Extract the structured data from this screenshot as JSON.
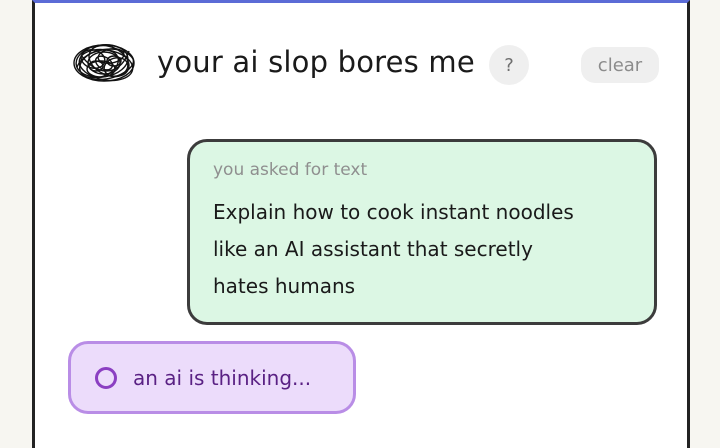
{
  "header": {
    "logo_icon": "scribble-logo-icon",
    "title": "your ai slop bores me",
    "help_label": "?",
    "clear_label": "clear"
  },
  "conversation": {
    "user_message": {
      "caption": "you asked for text",
      "lines": [
        "Explain how to cook instant noodles",
        "like an AI assistant that secretly",
        "hates humans"
      ]
    },
    "status": {
      "spinner_icon": "loading-ring-icon",
      "text": "an ai is thinking..."
    }
  },
  "colors": {
    "top_accent": "#5b6bd6",
    "user_bubble_bg": "#dcf7e4",
    "thinking_bg": "#ecdcfb",
    "thinking_border": "#b98de6",
    "thinking_text": "#5a2184"
  }
}
